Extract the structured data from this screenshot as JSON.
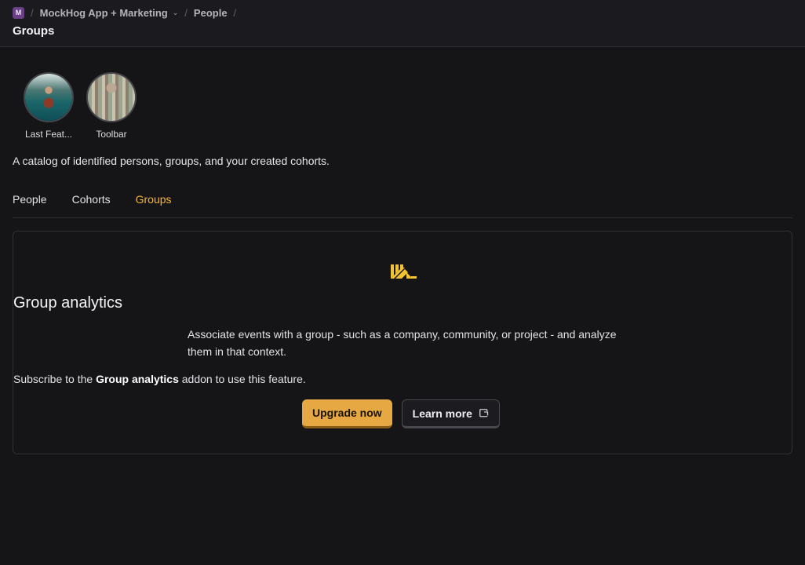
{
  "breadcrumb": {
    "project_initial": "M",
    "project_name": "MockHog App + Marketing",
    "section": "People"
  },
  "header": {
    "title": "Groups"
  },
  "stories": [
    {
      "label": "Last Feat..."
    },
    {
      "label": "Toolbar"
    }
  ],
  "description": "A catalog of identified persons, groups, and your created cohorts.",
  "tabs": [
    {
      "label": "People"
    },
    {
      "label": "Cohorts"
    },
    {
      "label": "Groups",
      "active": true
    }
  ],
  "empty_state": {
    "title": "Group analytics",
    "description": "Associate events with a group - such as a company, community, or project - and analyze them in that context.",
    "subscribe_prefix": "Subscribe to the ",
    "subscribe_addon": "Group analytics",
    "subscribe_suffix": " addon to use this feature.",
    "primary_button": "Upgrade now",
    "secondary_button": "Learn more"
  },
  "colors": {
    "accent": "#f6b634",
    "primary_button": "#e6a842",
    "background": "#151518"
  }
}
